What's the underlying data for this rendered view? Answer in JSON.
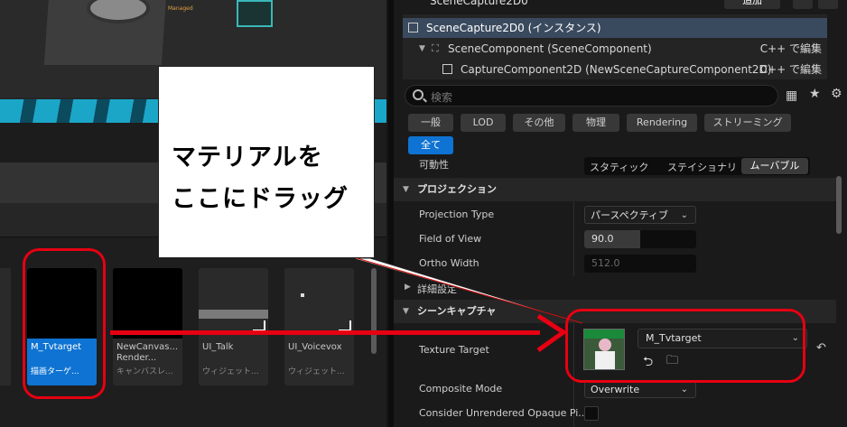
{
  "viewport": {
    "badge_text": "Managed"
  },
  "details": {
    "header_title": "SceneCapture2D0",
    "add_button": "追加",
    "tree": [
      {
        "label": "SceneCapture2D0 (インスタンス)",
        "edit": ""
      },
      {
        "label": "SceneComponent (SceneComponent)",
        "edit": "C++ で編集"
      },
      {
        "label": "CaptureComponent2D (NewSceneCaptureComponent2D)",
        "edit": "C++ で編集"
      }
    ],
    "search_placeholder": "検索",
    "filters": [
      "一般",
      "LOD",
      "その他",
      "物理",
      "Rendering",
      "ストリーミング",
      "全て"
    ],
    "mobility": {
      "label": "可動性",
      "options": [
        "スタティック",
        "ステイショナリ",
        "ムーバブル"
      ]
    },
    "section_projection": "プロジェクション",
    "projection_type": {
      "label": "Projection Type",
      "value": "パースペクティブ"
    },
    "field_of_view": {
      "label": "Field of View",
      "value": "90.0",
      "fill_fraction": 0.5
    },
    "ortho_width": {
      "label": "Ortho Width",
      "value": "512.0"
    },
    "section_advanced": "詳細設定",
    "section_scene_capture": "シーンキャプチャ",
    "texture_target": {
      "label": "Texture Target",
      "value": "M_Tvtarget"
    },
    "composite_mode": {
      "label": "Composite Mode",
      "value": "Overwrite"
    },
    "consider_unrendered": {
      "label": "Consider Unrendered Opaque Pi..."
    }
  },
  "content_browser": {
    "assets": [
      {
        "name": "M_Tvtarget",
        "type": "描画ターゲ..."
      },
      {
        "name": "NewCanvas...",
        "name2": "Render...",
        "type": "キャンバスレ..."
      },
      {
        "name": "UI_Talk",
        "type": "ウィジェット..."
      },
      {
        "name": "UI_Voicevox",
        "type": "ウィジェット..."
      }
    ]
  },
  "annotation": {
    "line1": "マテリアルを",
    "line2": "ここにドラッグ"
  },
  "colors": {
    "accent": "#0e73d2",
    "annotation_red": "#e60012"
  }
}
